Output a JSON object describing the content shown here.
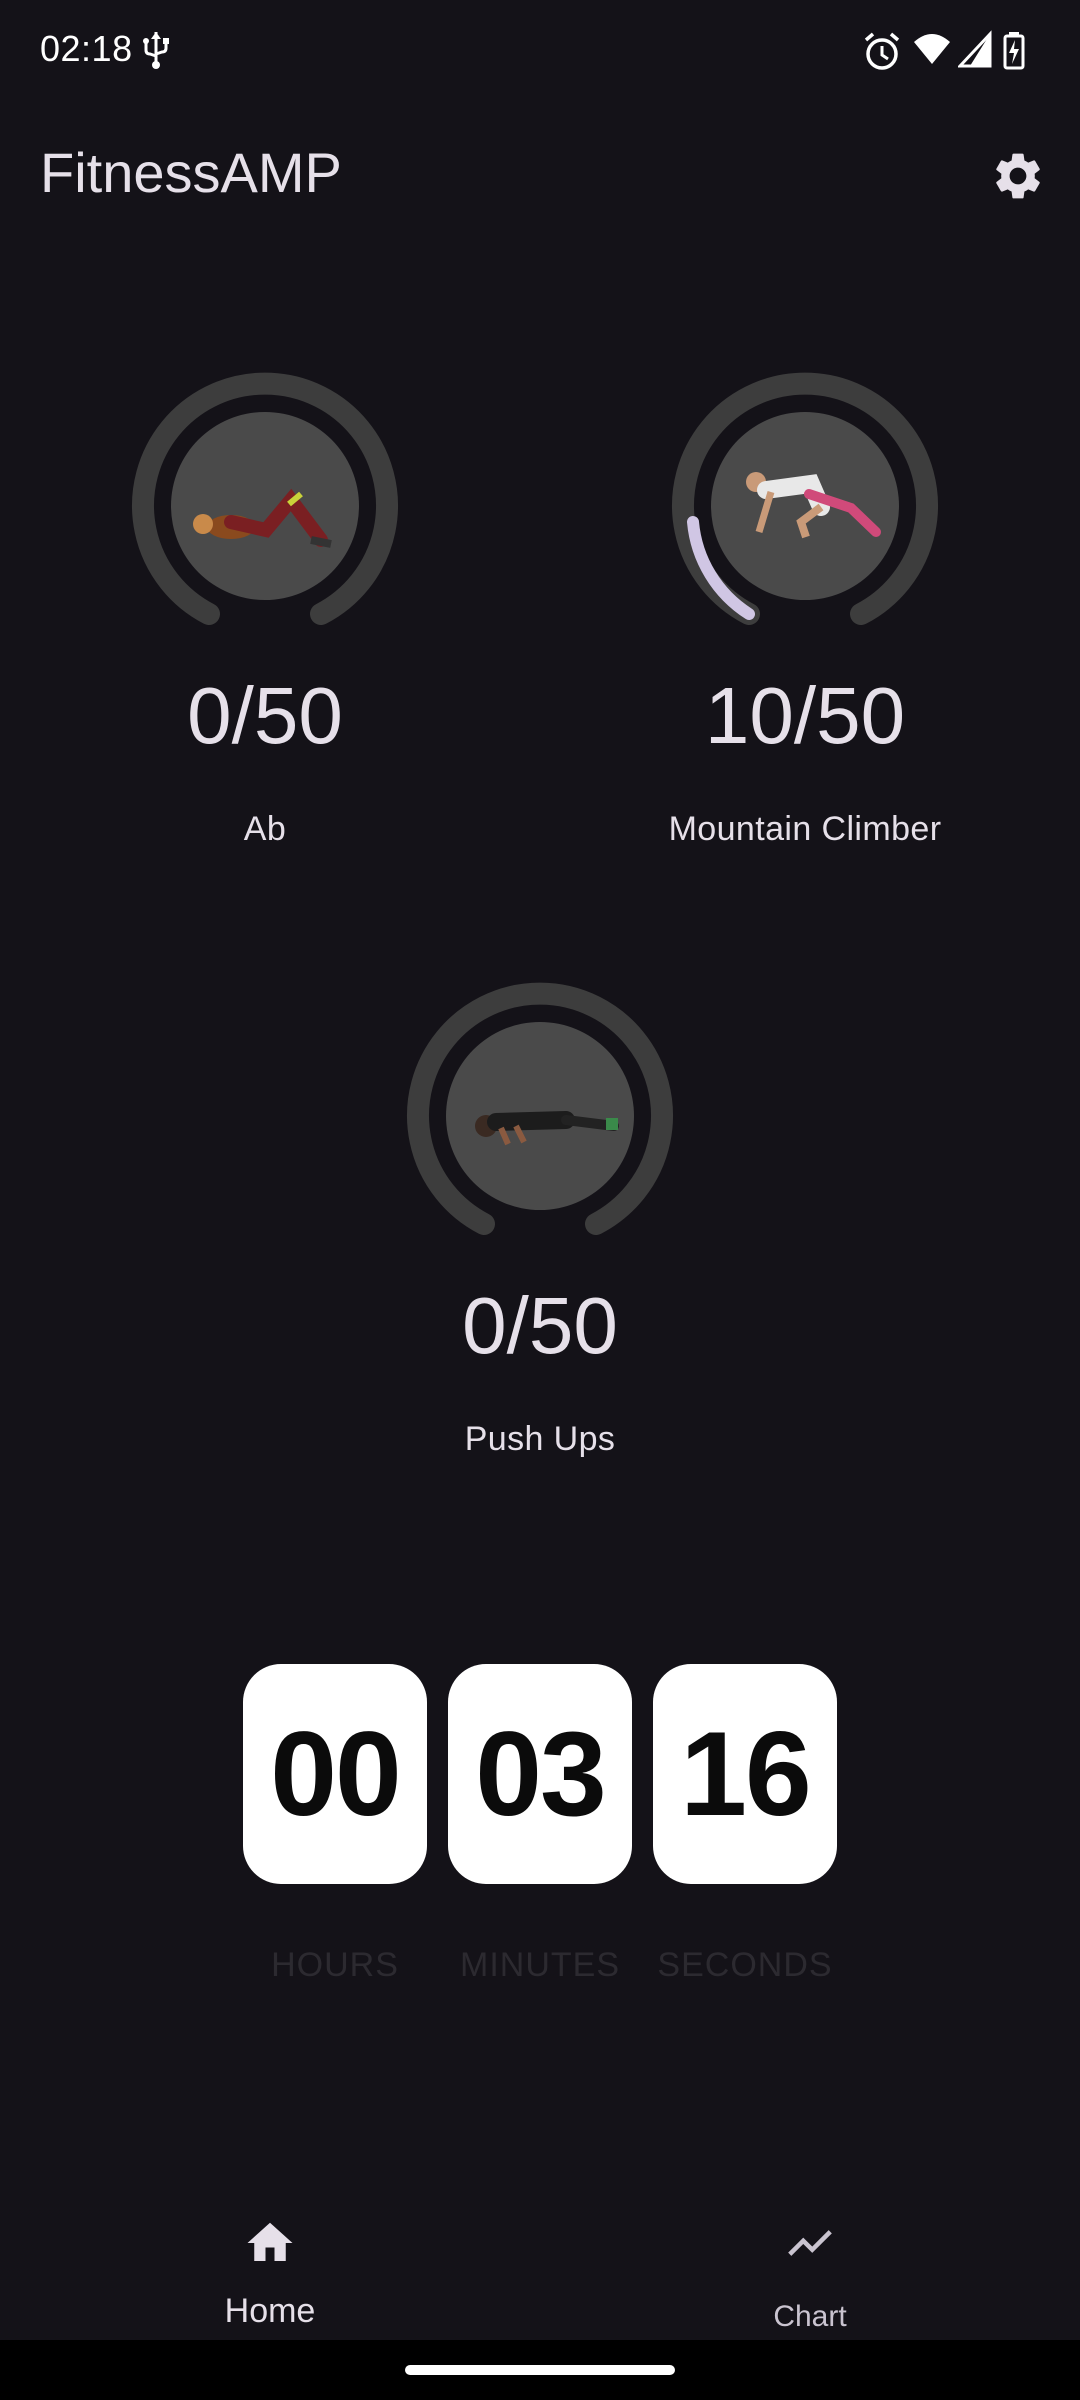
{
  "status_bar": {
    "time": "02:18",
    "icons": [
      "usb-icon",
      "alarm-icon",
      "wifi-icon",
      "cell-signal-icon",
      "battery-charging-icon"
    ]
  },
  "app_bar": {
    "title": "FitnessAMP",
    "settings_icon": "gear-icon"
  },
  "exercises": [
    {
      "name": "Ab",
      "count": "0/50",
      "progress": 0.0
    },
    {
      "name": "Mountain Climber",
      "count": "10/50",
      "progress": 0.2
    },
    {
      "name": "Push Ups",
      "count": "0/50",
      "progress": 0.0
    }
  ],
  "timer": {
    "hours": "00",
    "minutes": "03",
    "seconds": "16",
    "hours_label": "HOURS",
    "minutes_label": "MINUTES",
    "seconds_label": "SECONDS"
  },
  "bottom_nav": {
    "items": [
      {
        "label": "Home",
        "icon": "home-icon",
        "selected": true
      },
      {
        "label": "Chart",
        "icon": "chart-line-icon",
        "selected": false
      }
    ]
  },
  "colors": {
    "background": "#141218",
    "ring_track": "#3d3d3d",
    "ring_progress": "#d0c6e4",
    "timer_box": "#ffffff",
    "accent": "#d0bcff"
  }
}
